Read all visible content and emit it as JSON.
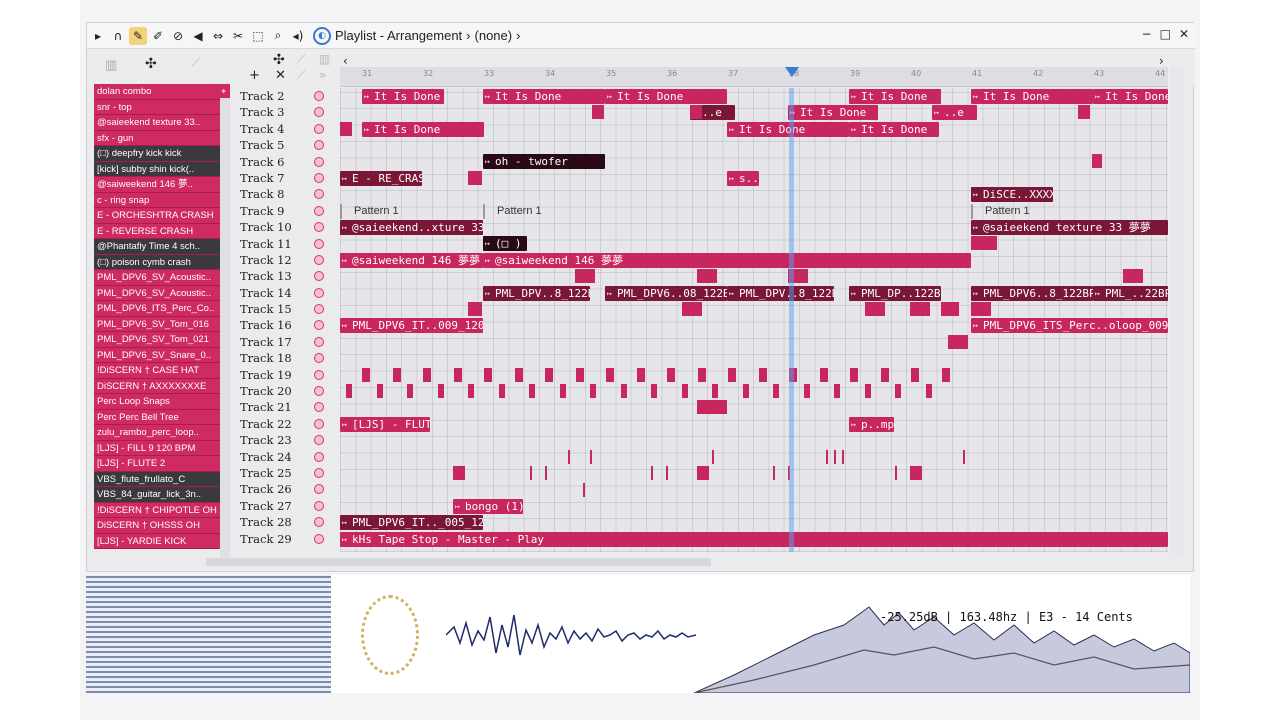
{
  "window": {
    "title": "Playlist - Arrangement",
    "pattern_selector": "(none)",
    "controls": [
      "−",
      "□",
      "✕"
    ]
  },
  "instruments": [
    {
      "label": "dolan combo",
      "dark": false
    },
    {
      "label": "snr - top",
      "dark": false
    },
    {
      "label": "@saieekend texture 33..",
      "dark": false
    },
    {
      "label": "sfx - gun",
      "dark": false
    },
    {
      "label": "(□) deepfry kick kick",
      "dark": true
    },
    {
      "label": "[kick] subby shin kick(..",
      "dark": true
    },
    {
      "label": "@saiweekend 146 夢..",
      "dark": false
    },
    {
      "label": "c - ring snap",
      "dark": false
    },
    {
      "label": "E - ORCHESHTRA CRASH",
      "dark": false
    },
    {
      "label": "E - REVERSE CRASH",
      "dark": false
    },
    {
      "label": "@Phantafiy Time 4 sch..",
      "dark": true
    },
    {
      "label": "(□) poison cymb crash",
      "dark": true
    },
    {
      "label": "PML_DPV6_SV_Acoustic..",
      "dark": false
    },
    {
      "label": "PML_DPV6_SV_Acoustic..",
      "dark": false
    },
    {
      "label": "PML_DPV6_ITS_Perc_Co..",
      "dark": false
    },
    {
      "label": "PML_DPV6_SV_Tom_016",
      "dark": false
    },
    {
      "label": "PML_DPV6_SV_Tom_021",
      "dark": false
    },
    {
      "label": "PML_DPV6_SV_Snare_0..",
      "dark": false
    },
    {
      "label": "!DiSCERN † CASE HAT",
      "dark": false
    },
    {
      "label": "DiSCERN † AXXXXXXXE",
      "dark": false
    },
    {
      "label": "Perc Loop Snaps",
      "dark": false
    },
    {
      "label": "Perc Perc Bell Tree",
      "dark": false
    },
    {
      "label": "zulu_rambo_perc_loop..",
      "dark": false
    },
    {
      "label": "[LJS] - FILL 9 120 BPM",
      "dark": false
    },
    {
      "label": "[LJS] - FLUTE 2",
      "dark": false
    },
    {
      "label": "VBS_flute_frullato_C",
      "dark": true
    },
    {
      "label": "VBS_84_guitar_lick_3n..",
      "dark": true
    },
    {
      "label": "!DiSCERN † CHIPOTLE OH",
      "dark": false
    },
    {
      "label": "DiSCERN † OHSSS OH",
      "dark": false
    },
    {
      "label": "[LJS] - YARDIE KICK",
      "dark": false
    }
  ],
  "tracks": [
    "Track 2",
    "Track 3",
    "Track 4",
    "Track 5",
    "Track 6",
    "Track 7",
    "Track 8",
    "Track 9",
    "Track 10",
    "Track 11",
    "Track 12",
    "Track 13",
    "Track 14",
    "Track 15",
    "Track 16",
    "Track 17",
    "Track 18",
    "Track 19",
    "Track 20",
    "Track 21",
    "Track 22",
    "Track 23",
    "Track 24",
    "Track 25",
    "Track 26",
    "Track 27",
    "Track 28",
    "Track 29"
  ],
  "clips": {
    "t2_a": "It Is Done",
    "t2_b": "It Is Done",
    "t2_c": "It Is Done",
    "t2_d": "It Is Done",
    "t2_e": "It Is Done",
    "t2_f": "It Is Done",
    "t3_a": "..e",
    "t3_b": "It Is Done",
    "t3_c": "..e",
    "t4_a": "It Is Done",
    "t4_b": "It Is Done",
    "t4_c": "It Is Done",
    "t6_a": "oh - twofer",
    "t7_a": "E - RE_CRASH",
    "t7_b": "s..n",
    "t8_a": "DiSCE..XXXXXE",
    "t9_a": "Pattern 1",
    "t9_b": "Pattern 1",
    "t9_c": "Pattern 1",
    "t10_a": "@saieekend..xture 33 夢夢",
    "t10_b": "@saieekend texture 33 夢夢",
    "t11_a": "(□ )",
    "t12_a": "@saiweekend 146 夢夢",
    "t12_b": "@saiweekend 146 夢夢",
    "t14_a": "PML_DPV..8_122BPM",
    "t14_b": "PML_DPV6..08_122BPM",
    "t14_c": "PML_DPV..8_122BPM",
    "t14_d": "PML_DP..122BPM",
    "t14_e": "PML_DPV6..8_122BPM",
    "t14_f": "PML_..22BPM",
    "t16_a": "PML_DPV6_IT..009_120BPM",
    "t16_b": "PML_DPV6_ITS_Perc..oloop_009_120BPM",
    "t22_a": "[LJS] - FLUTE 2",
    "t22_b": "p..mp",
    "t27_a": "bongo (1)",
    "t28_a": "PML_DPV6_IT.._005_120BPM",
    "t29_a": "kHs Tape Stop - Master - Play"
  },
  "ruler_numbers": [
    "31",
    "32",
    "33",
    "34",
    "35",
    "36",
    "37",
    "38",
    "39",
    "40",
    "41",
    "42",
    "43",
    "44"
  ],
  "visualizer": {
    "readout": "-25.25dB | 163.48hz | E3 - 14 Cents"
  }
}
